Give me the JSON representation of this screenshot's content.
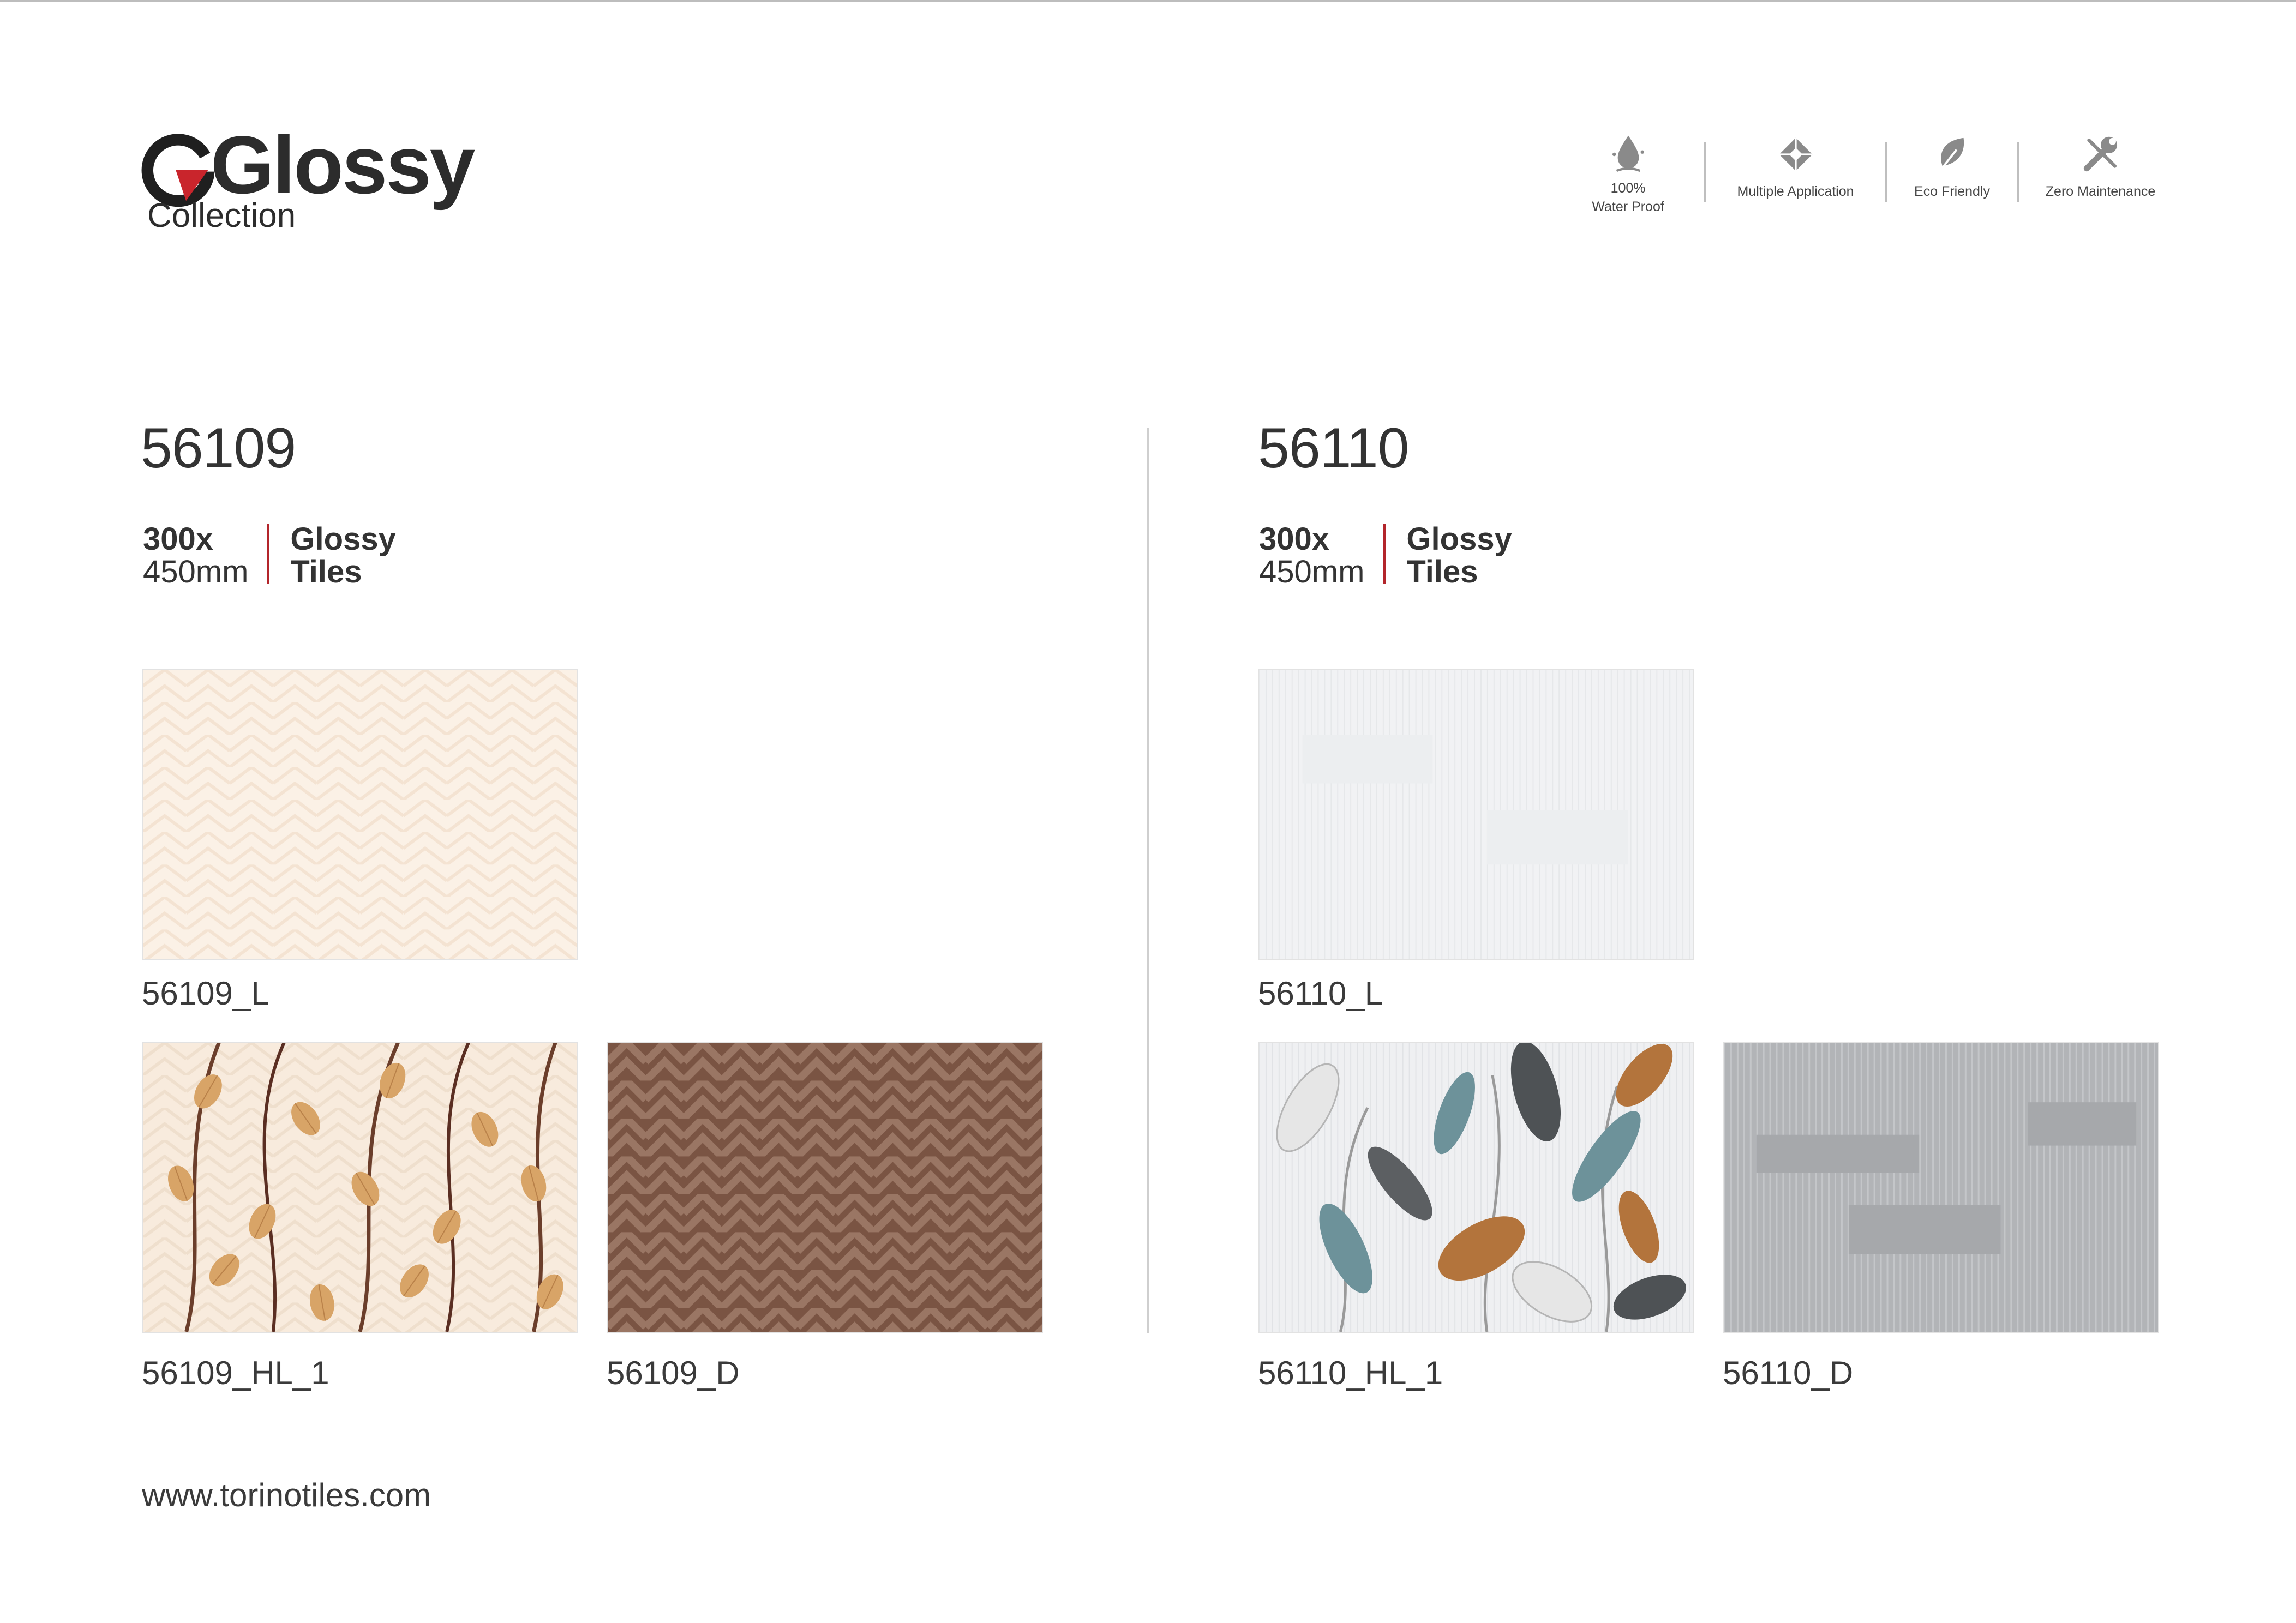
{
  "brand": {
    "name": "Glossy",
    "subtitle": "Collection"
  },
  "features": [
    {
      "icon": "water-drop-icon",
      "line1": "100%",
      "line2": "Water Proof"
    },
    {
      "icon": "multiple-application-icon",
      "line1": "",
      "line2": "Multiple Application"
    },
    {
      "icon": "leaf-icon",
      "line1": "",
      "line2": "Eco Friendly"
    },
    {
      "icon": "tools-icon",
      "line1": "",
      "line2": "Zero Maintenance"
    }
  ],
  "series": [
    {
      "code": "56109",
      "size_line1": "300x",
      "size_line2": "450mm",
      "type_line1": "Glossy",
      "type_line2": "Tiles",
      "tiles": [
        {
          "label": "56109_L",
          "finish": "light"
        },
        {
          "label": "56109_HL_1",
          "finish": "highlighter"
        },
        {
          "label": "56109_D",
          "finish": "dark"
        }
      ]
    },
    {
      "code": "56110",
      "size_line1": "300x",
      "size_line2": "450mm",
      "type_line1": "Glossy",
      "type_line2": "Tiles",
      "tiles": [
        {
          "label": "56110_L",
          "finish": "light"
        },
        {
          "label": "56110_HL_1",
          "finish": "highlighter"
        },
        {
          "label": "56110_D",
          "finish": "dark"
        }
      ]
    }
  ],
  "website": "www.torinotiles.com",
  "colors": {
    "accent": "#b3252b",
    "text": "#333333",
    "divider": "#cfcfcf"
  }
}
